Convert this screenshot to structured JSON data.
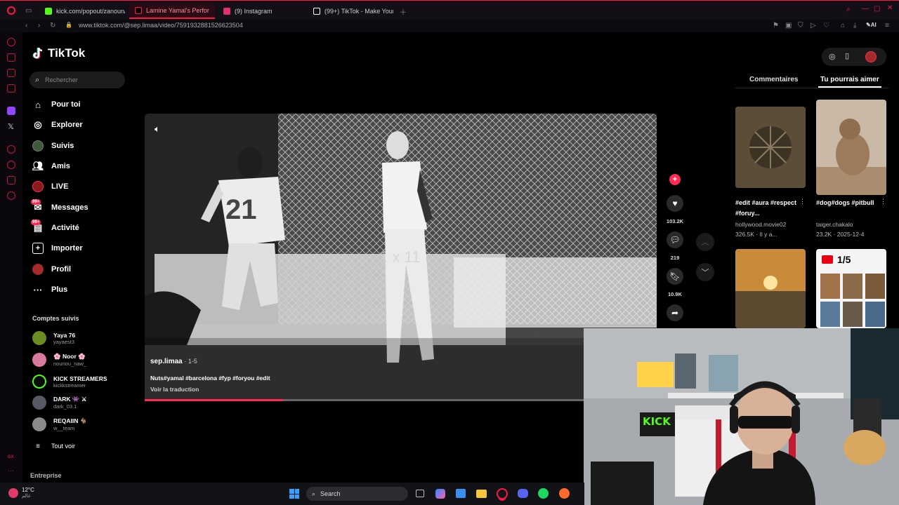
{
  "browser": {
    "tabs": [
      {
        "label": "kick.com/popout/zanoun/",
        "color": "#53fc18"
      },
      {
        "label": "Lamine Yamal's Perfor",
        "color": "#ff1744"
      },
      {
        "label": "(9) Instagram",
        "color": "#e1306c"
      },
      {
        "label": "(99+) TikTok - Make Your",
        "color": "#ffffff"
      }
    ],
    "url": "www.tiktok.com/@sep.limaa/video/7591932881526623504",
    "ai_label": "AI"
  },
  "tiktok": {
    "logo": "TikTok",
    "search_placeholder": "Rechercher",
    "nav": [
      {
        "label": "Pour toi",
        "icon": "home-icon"
      },
      {
        "label": "Explorer",
        "icon": "compass-icon"
      },
      {
        "label": "Suivis",
        "icon": "following-avatar-icon"
      },
      {
        "label": "Amis",
        "icon": "friends-icon"
      },
      {
        "label": "LIVE",
        "icon": "live-avatar-icon"
      },
      {
        "label": "Messages",
        "icon": "messages-icon",
        "badge": "99+"
      },
      {
        "label": "Activité",
        "icon": "activity-icon",
        "badge": "99+"
      },
      {
        "label": "Importer",
        "icon": "upload-icon"
      },
      {
        "label": "Profil",
        "icon": "profile-avatar-icon"
      },
      {
        "label": "Plus",
        "icon": "more-icon"
      }
    ],
    "followed_title": "Comptes suivis",
    "followed": [
      {
        "name": "Yaya 76",
        "handle": "yayaest3",
        "color": "#6b8e23"
      },
      {
        "name": "🌸 Noor 🌸",
        "handle": "nounou_naw_",
        "color": "#d87aa0"
      },
      {
        "name": "KICK STREAMERS",
        "handle": "kickkstreamer",
        "color": "#53fc18"
      },
      {
        "name": "DARK 👾 ⚔",
        "handle": "dark_03.1",
        "color": "#555a66"
      },
      {
        "name": "REQAIIN 🐐",
        "handle": "w__team",
        "color": "#8a8a8a"
      }
    ],
    "see_all": "Tout voir",
    "enterprise": "Entreprise"
  },
  "video": {
    "author": "sep.limaa",
    "date": "· 1-5",
    "caption": "Nuts#yamal #barcelona #fyp #foryou #edit",
    "translate": "Voir la traduction",
    "overlay_text": "1 x 11",
    "jersey_number": "21",
    "progress": 0.27,
    "likes": "103.2K",
    "comments": "219",
    "saves": "10.9K"
  },
  "right_panel": {
    "tabs": [
      "Commentaires",
      "Tu pourrais aimer"
    ],
    "active_tab": "Tu pourrais aimer",
    "cards": [
      {
        "caption": "#edit #aura #respect #foruy...",
        "author": "hollywood.movie02",
        "stats": "326.5K · Il y a..."
      },
      {
        "caption": "#dog#dogs #pitbull",
        "author": "taiger.chakalo",
        "stats": "23.2K · 2025-12-4"
      }
    ],
    "card4_label": "1/5"
  },
  "webcam": {
    "sign_text": "KICK"
  },
  "taskbar": {
    "weather_temp": "12°C",
    "weather_text": "عالم",
    "search_label": "Search"
  },
  "colors": {
    "accent": "#fe2c55",
    "opera": "#ff1744"
  }
}
